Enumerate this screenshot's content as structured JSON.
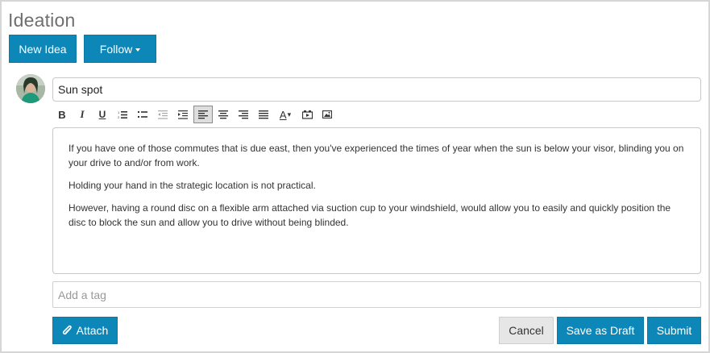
{
  "page": {
    "title": "Ideation"
  },
  "header": {
    "new_idea_label": "New Idea",
    "follow_label": "Follow"
  },
  "form": {
    "title_value": "Sun spot",
    "toolbar": [
      {
        "name": "bold-icon",
        "glyph": "B"
      },
      {
        "name": "italic-icon",
        "glyph": "I"
      },
      {
        "name": "underline-icon",
        "glyph": "U"
      },
      {
        "name": "ordered-list-icon"
      },
      {
        "name": "unordered-list-icon"
      },
      {
        "name": "outdent-icon"
      },
      {
        "name": "indent-icon"
      },
      {
        "name": "align-left-icon",
        "active": true
      },
      {
        "name": "align-center-icon"
      },
      {
        "name": "align-right-icon"
      },
      {
        "name": "justify-icon"
      },
      {
        "name": "font-color-icon",
        "glyph": "A"
      },
      {
        "name": "insert-video-icon"
      },
      {
        "name": "insert-image-icon"
      }
    ],
    "body_paragraphs": [
      "If you have one of those commutes that is due east, then you've experienced the times of year when the sun is below your visor, blinding you on your drive to and/or from work.",
      "Holding your hand in the strategic location is not practical.",
      "However, having a round disc on a flexible arm attached via suction cup to your windshield, would allow you to easily and quickly position the disc to block the sun and allow you to drive without being blinded."
    ],
    "tag_placeholder": "Add a tag"
  },
  "actions": {
    "attach_label": "Attach",
    "cancel_label": "Cancel",
    "save_draft_label": "Save as Draft",
    "submit_label": "Submit"
  },
  "colors": {
    "accent": "#0c87b8",
    "title_gray": "#6f6f6f",
    "border": "#c8c8c8"
  }
}
